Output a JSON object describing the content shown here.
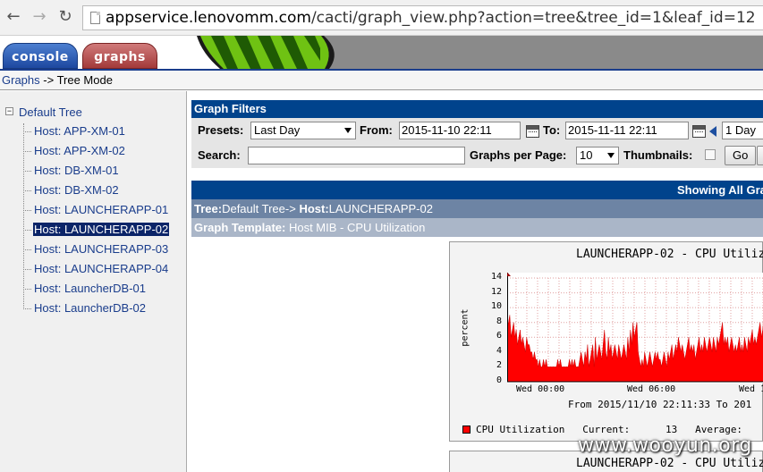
{
  "browser": {
    "url_prefix": "appservice.lenovomm.com",
    "url_rest": "/cacti/graph_view.php?action=tree&tree_id=1&leaf_id=12"
  },
  "tabs": {
    "console": "console",
    "graphs": "graphs"
  },
  "breadcrumb": {
    "link": "Graphs",
    "sep": " -> ",
    "current": "Tree Mode"
  },
  "tree": {
    "root_toggle": "−",
    "root": "Default Tree",
    "items": [
      "Host: APP-XM-01",
      "Host: APP-XM-02",
      "Host: DB-XM-01",
      "Host: DB-XM-02",
      "Host: LAUNCHERAPP-01",
      "Host: LAUNCHERAPP-02",
      "Host: LAUNCHERAPP-03",
      "Host: LAUNCHERAPP-04",
      "Host: LauncherDB-01",
      "Host: LauncherDB-02"
    ],
    "selected_index": 5
  },
  "filters": {
    "title": "Graph Filters",
    "presets_label": "Presets:",
    "presets_value": "Last Day",
    "from_label": "From:",
    "from_value": "2015-11-10 22:11",
    "to_label": "To:",
    "to_value": "2015-11-11 22:11",
    "span_value": "1 Day",
    "search_label": "Search:",
    "search_value": "",
    "gpp_label": "Graphs per Page:",
    "gpp_value": "10",
    "thumbs_label": "Thumbnails:",
    "go_label": "Go"
  },
  "showing": "Showing All Grap",
  "tree_row": {
    "tree_label": "Tree:",
    "tree_value": "Default Tree-> ",
    "host_label": "Host:",
    "host_value": "LAUNCHERAPP-02"
  },
  "template_row": {
    "label": "Graph Template:",
    "value": " Host MIB - CPU Utilization"
  },
  "graph": {
    "title": "LAUNCHERAPP-02 - CPU Utiliz",
    "ylabel": "percent",
    "yticks": [
      "14",
      "12",
      "10",
      "8",
      "6",
      "4",
      "2",
      "0"
    ],
    "xticks": [
      "Wed 00:00",
      "Wed 06:00",
      "Wed 1"
    ],
    "from_text": "From 2015/11/10 22:11:33 To 201",
    "legend_label": "CPU Utilization",
    "current_label": "Current:",
    "current_value": "13",
    "average_label": "Average:",
    "series_color": "#ff0000"
  },
  "graph2": {
    "title": "LAUNCHERAPP-02 - CPU Utiliz"
  },
  "watermark": "www.wooyun.org",
  "chart_data": {
    "type": "area",
    "title": "LAUNCHERAPP-02 - CPU Utiliz",
    "ylabel": "percent",
    "ylim": [
      0,
      14
    ],
    "x_tick_labels": [
      "Wed 00:00",
      "Wed 06:00",
      "Wed 1"
    ],
    "grid": true,
    "series": [
      {
        "name": "CPU Utilization",
        "values": [
          7,
          8,
          9,
          6,
          7,
          8,
          6,
          7,
          5,
          6,
          7,
          5,
          6,
          5,
          4,
          6,
          5,
          5,
          4,
          4,
          3,
          4,
          3,
          3,
          2,
          3,
          2,
          2,
          3,
          2,
          3,
          2,
          2,
          2,
          2,
          2,
          2,
          2,
          2,
          3,
          2,
          3,
          2,
          2,
          2,
          2,
          2,
          2,
          3,
          2,
          3,
          2,
          3,
          2,
          2,
          2,
          3,
          4,
          3,
          2,
          4,
          3,
          5,
          2,
          3,
          4,
          5,
          2,
          6,
          3,
          4,
          5,
          4,
          3,
          5,
          7,
          4,
          3,
          6,
          4,
          5,
          3,
          4,
          5,
          4,
          3,
          5,
          4,
          3,
          4,
          5,
          4,
          3,
          6,
          4,
          7,
          5,
          8,
          6,
          7,
          8,
          4,
          3,
          2,
          3,
          2,
          4,
          3,
          2,
          3,
          4,
          3,
          2,
          3,
          4,
          3,
          4,
          3,
          3,
          2,
          3,
          4,
          3,
          2,
          4,
          3,
          4,
          5,
          3,
          4,
          5,
          4,
          6,
          5,
          4,
          5,
          4,
          3,
          4,
          5,
          6,
          4,
          5,
          4,
          5,
          3,
          4,
          5,
          6,
          4,
          5,
          4,
          6,
          5,
          4,
          5,
          6,
          5,
          4,
          6,
          5,
          4,
          6,
          5,
          6,
          7,
          8,
          5,
          6,
          5,
          6,
          4,
          5,
          6,
          5,
          4,
          5,
          4,
          5,
          6,
          4,
          5,
          4,
          6,
          5,
          4,
          6,
          5,
          6,
          7,
          5,
          6,
          5,
          6,
          7,
          8,
          6,
          7,
          9,
          11,
          13
        ]
      }
    ]
  }
}
